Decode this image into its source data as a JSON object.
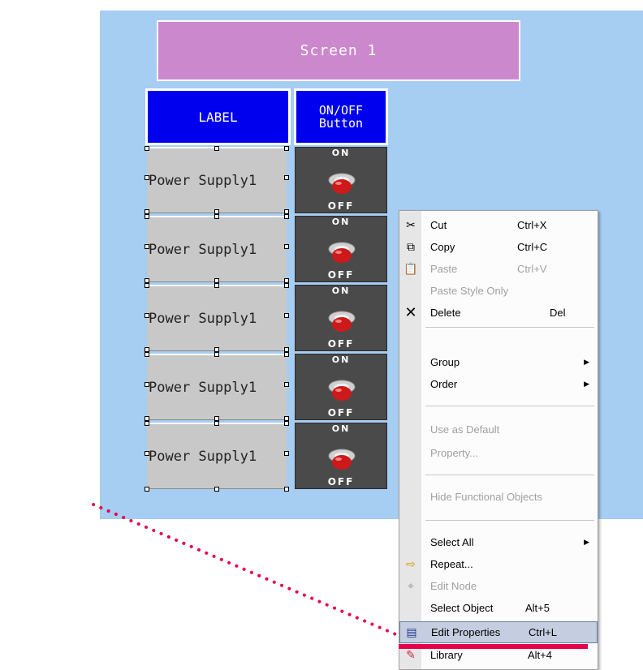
{
  "screen": {
    "title": "Screen 1"
  },
  "headers": {
    "label": "LABEL",
    "button_line1": "ON/OFF",
    "button_line2": "Button"
  },
  "rows": [
    {
      "label": "Power Supply1",
      "on": "ON",
      "off": "OFF"
    },
    {
      "label": "Power Supply1",
      "on": "ON",
      "off": "OFF"
    },
    {
      "label": "Power Supply1",
      "on": "ON",
      "off": "OFF"
    },
    {
      "label": "Power Supply1",
      "on": "ON",
      "off": "OFF"
    },
    {
      "label": "Power Supply1",
      "on": "ON",
      "off": "OFF"
    }
  ],
  "context_menu": {
    "items": [
      {
        "label": "Cut",
        "shortcut": "Ctrl+X",
        "icon": "scissors-icon"
      },
      {
        "label": "Copy",
        "shortcut": "Ctrl+C",
        "icon": "copy-icon"
      },
      {
        "label": "Paste",
        "shortcut": "Ctrl+V",
        "icon": "paste-icon",
        "disabled": true
      },
      {
        "label": "Paste Style Only",
        "shortcut": "",
        "disabled": true
      },
      {
        "label": "Delete",
        "shortcut": "Del",
        "icon": "delete-x-icon"
      },
      {
        "label": "Group",
        "submenu": true
      },
      {
        "label": "Order",
        "submenu": true
      },
      {
        "label": "Use as Default",
        "disabled": true
      },
      {
        "label": "Property...",
        "disabled": true
      },
      {
        "label": "Hide Functional Objects",
        "disabled": true
      },
      {
        "label": "Select All",
        "submenu": true
      },
      {
        "label": "Repeat...",
        "icon": "repeat-icon"
      },
      {
        "label": "Edit Node",
        "icon": "edit-node-icon",
        "disabled": true
      },
      {
        "label": "Select Object",
        "shortcut": "Alt+5"
      },
      {
        "label": "Edit Properties",
        "shortcut": "Ctrl+L",
        "icon": "edit-properties-icon",
        "highlighted": true
      },
      {
        "label": "Library",
        "shortcut": "Alt+4",
        "icon": "library-icon"
      }
    ]
  },
  "colors": {
    "canvas": "#a6cdf2",
    "screen_title_bg": "#cc88cc",
    "header_bg": "#0000ee",
    "annotation": "#e8004a"
  }
}
